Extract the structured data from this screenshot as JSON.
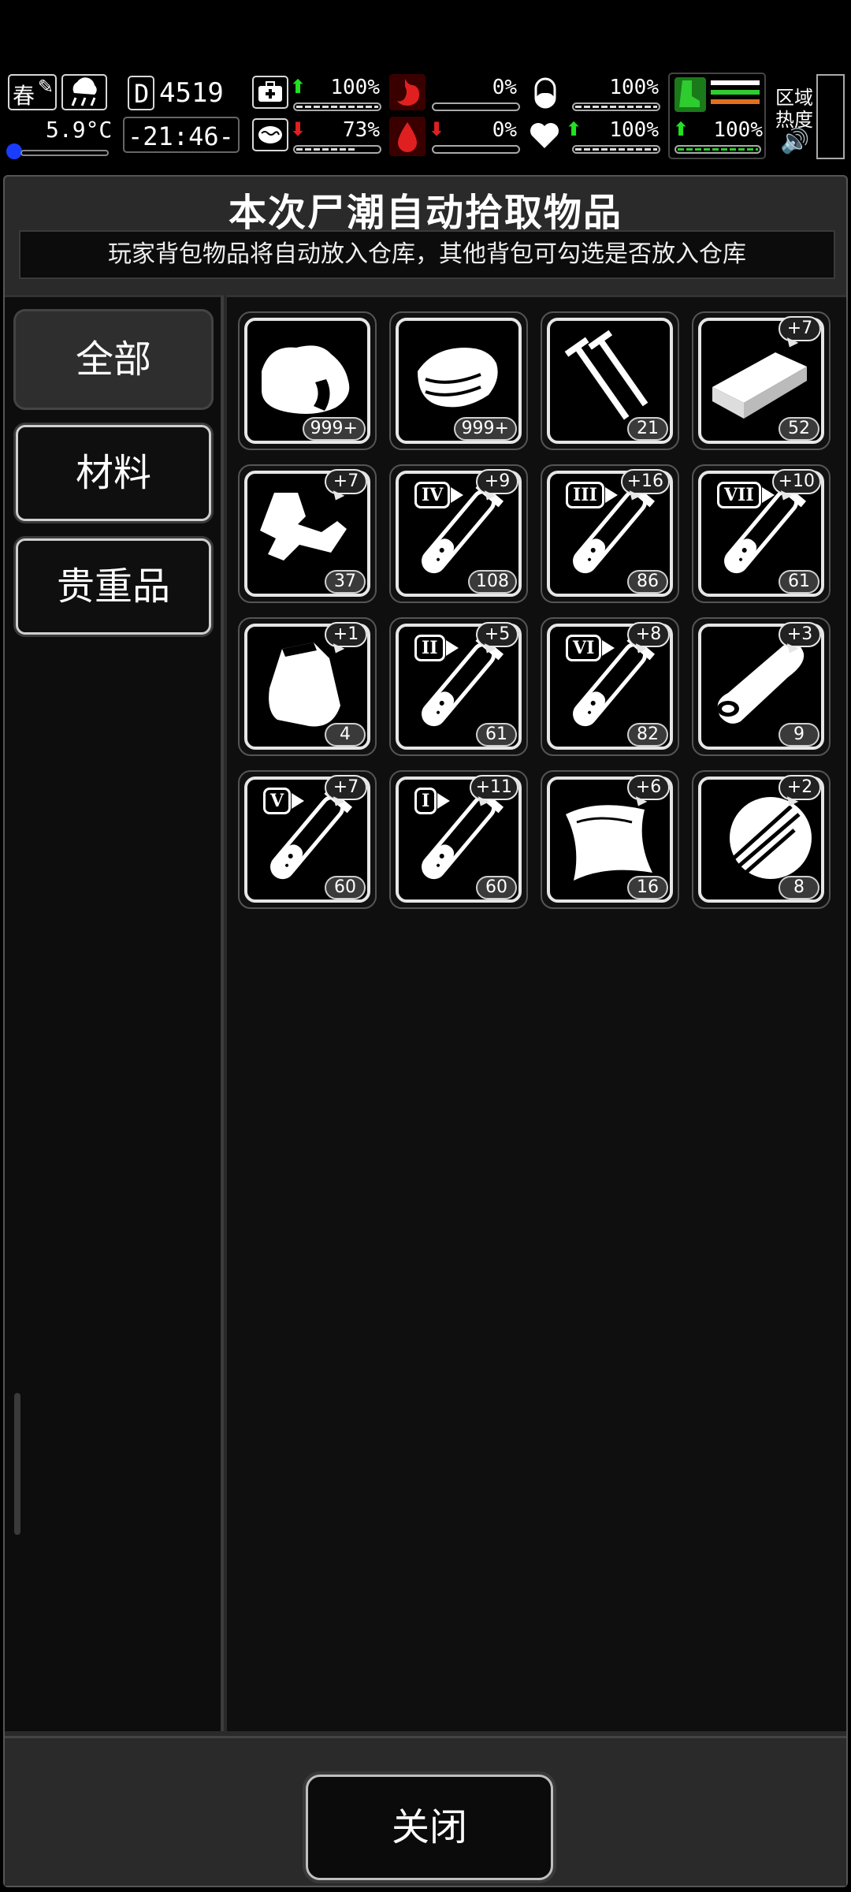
{
  "hud": {
    "season": "春",
    "temperature": "5.9°C",
    "day": "4519",
    "day_prefix": "D",
    "time": "-21:46-",
    "stats": {
      "health": {
        "value": "100%",
        "trend": "up",
        "level": 1.0
      },
      "stomach": {
        "value": "0%",
        "trend": "none",
        "level": 0.0
      },
      "water": {
        "value": "100%",
        "trend": "none",
        "level": 1.0
      },
      "mental": {
        "value": "73%",
        "trend": "down",
        "level": 0.73
      },
      "blood": {
        "value": "0%",
        "trend": "down",
        "level": 0.0
      },
      "heart": {
        "value": "100%",
        "trend": "up",
        "level": 1.0
      },
      "stamina": {
        "value": "100%",
        "trend": "up",
        "level": 1.0
      }
    },
    "zone_heat_label": "区域热度",
    "zone_heat_line1": "区域",
    "zone_heat_line2": "热度"
  },
  "panel": {
    "title": "本次尸潮自动拾取物品",
    "subtitle": "玩家背包物品将自动放入仓库，其他背包可勾选是否放入仓库"
  },
  "tabs": [
    {
      "label": "全部",
      "active": true
    },
    {
      "label": "材料",
      "active": false
    },
    {
      "label": "贵重品",
      "active": false
    }
  ],
  "items": [
    {
      "icon": "raw-meat",
      "count": "999+",
      "bonus": null,
      "roman": null
    },
    {
      "icon": "cloth",
      "count": "999+",
      "bonus": null,
      "roman": null
    },
    {
      "icon": "nails",
      "count": "21",
      "bonus": null,
      "roman": null
    },
    {
      "icon": "wood-plank",
      "count": "52",
      "bonus": "+7",
      "roman": null
    },
    {
      "icon": "scrap-metal",
      "count": "37",
      "bonus": "+7",
      "roman": null
    },
    {
      "icon": "test-tube",
      "count": "108",
      "bonus": "+9",
      "roman": "IV"
    },
    {
      "icon": "test-tube",
      "count": "86",
      "bonus": "+16",
      "roman": "III"
    },
    {
      "icon": "test-tube",
      "count": "61",
      "bonus": "+10",
      "roman": "VII"
    },
    {
      "icon": "pouch",
      "count": "4",
      "bonus": "+1",
      "roman": null
    },
    {
      "icon": "test-tube",
      "count": "61",
      "bonus": "+5",
      "roman": "II"
    },
    {
      "icon": "test-tube",
      "count": "82",
      "bonus": "+8",
      "roman": "VI"
    },
    {
      "icon": "log",
      "count": "9",
      "bonus": "+3",
      "roman": null
    },
    {
      "icon": "test-tube",
      "count": "60",
      "bonus": "+7",
      "roman": "V"
    },
    {
      "icon": "test-tube",
      "count": "60",
      "bonus": "+11",
      "roman": "I"
    },
    {
      "icon": "leather",
      "count": "16",
      "bonus": "+6",
      "roman": null
    },
    {
      "icon": "feather-wood",
      "count": "8",
      "bonus": "+2",
      "roman": null
    }
  ],
  "footer": {
    "close_label": "关闭"
  }
}
